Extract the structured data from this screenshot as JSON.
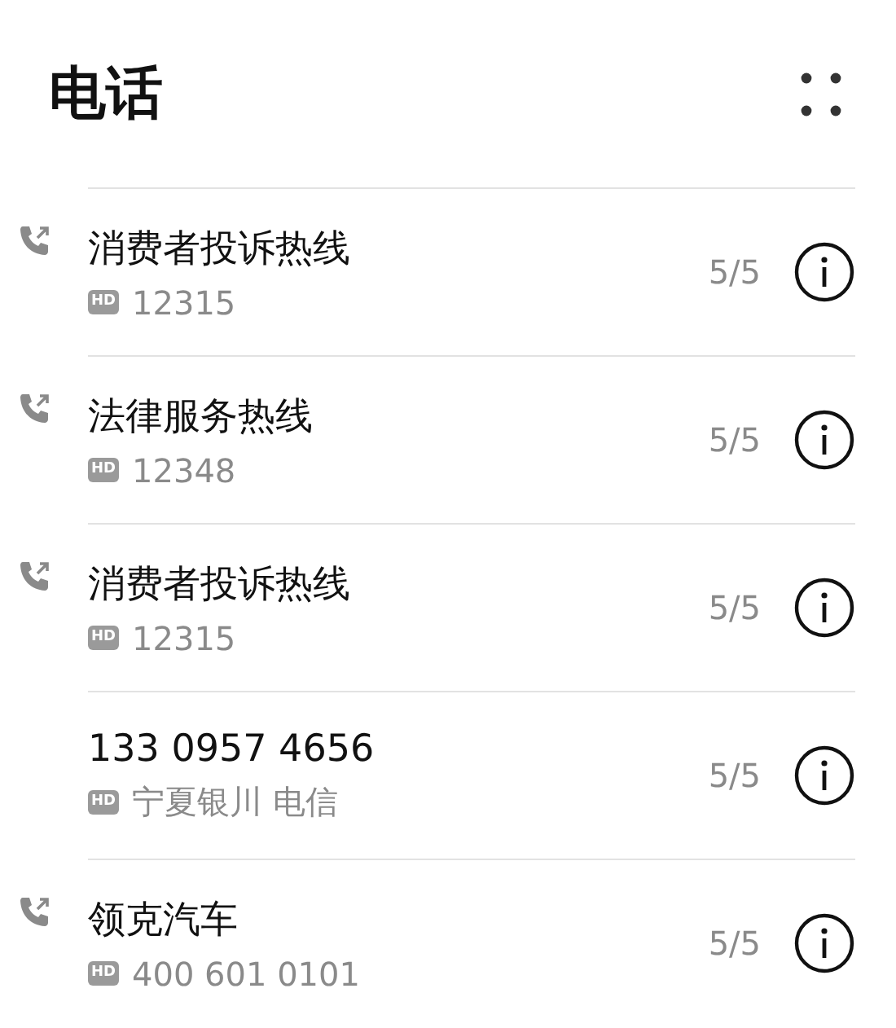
{
  "title": "电话",
  "calls": [
    {
      "name": "消费者投诉热线",
      "hd": "HD",
      "detail": "12315",
      "count": "5/5",
      "outgoing": true
    },
    {
      "name": "法律服务热线",
      "hd": "HD",
      "detail": "12348",
      "count": "5/5",
      "outgoing": true
    },
    {
      "name": "消费者投诉热线",
      "hd": "HD",
      "detail": "12315",
      "count": "5/5",
      "outgoing": true
    },
    {
      "name": "133 0957 4656",
      "hd": "HD",
      "detail": "宁夏银川 电信",
      "count": "5/5",
      "outgoing": false
    },
    {
      "name": "领克汽车",
      "hd": "HD",
      "detail": "400 601 0101",
      "count": "5/5",
      "outgoing": true
    }
  ]
}
